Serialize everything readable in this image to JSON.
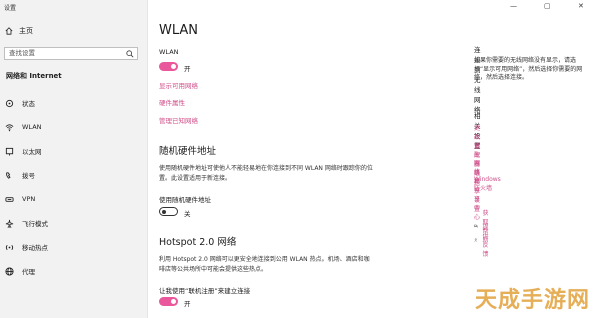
{
  "window": {
    "title": "设置",
    "controls": [
      "—",
      "▢",
      "✕"
    ]
  },
  "sidebar": {
    "home_label": "主页",
    "search_placeholder": "查找设置",
    "section_title": "网络和 Internet",
    "items": [
      {
        "label": "状态",
        "icon": "status-icon"
      },
      {
        "label": "WLAN",
        "icon": "wifi-icon"
      },
      {
        "label": "以太网",
        "icon": "ethernet-icon"
      },
      {
        "label": "拨号",
        "icon": "dialup-icon"
      },
      {
        "label": "VPN",
        "icon": "vpn-icon"
      },
      {
        "label": "飞行模式",
        "icon": "airplane-icon"
      },
      {
        "label": "移动热点",
        "icon": "hotspot-icon"
      },
      {
        "label": "代理",
        "icon": "globe-icon"
      }
    ]
  },
  "main": {
    "title": "WLAN",
    "wlan_label": "WLAN",
    "wlan_state": "开",
    "links": [
      "显示可用网络",
      "硬件属性",
      "管理已知网络"
    ],
    "random_section": {
      "title": "随机硬件地址",
      "description": "使用随机硬件地址可使他人不能轻易地在你连接到不同 WLAN 网络时跟踪你的位置。此设置适用于新连接。",
      "toggle_label": "使用随机硬件地址",
      "toggle_state": "关"
    },
    "hotspot_section": {
      "title": "Hotspot 2.0 网络",
      "description": "利用 Hotspot 2.0 网络可以更安全地连接到公用 WLAN 热点。机场、酒店和咖啡店等公共场所中可能会提供这些热点。",
      "toggle_label": "让我使用“联机注册”来建立连接",
      "toggle_state": "开"
    }
  },
  "right_panel": {
    "connect_title": "连接到无线网络",
    "connect_text": "如果你需要的无线网络没有显示，请选择“显示可用网络”，然后选择你需要的网络，然后选择连接。",
    "related_title": "相关设置",
    "related_links": [
      "更改适配器选项",
      "更改高级共享设置",
      "网络和共享中心",
      "Windows 防火墙"
    ],
    "help_links": [
      {
        "label": "获取帮助",
        "icon": "help-chat-icon"
      },
      {
        "label": "提供反馈",
        "icon": "feedback-icon"
      }
    ]
  },
  "watermark": "天成手游网",
  "colors": {
    "accent": "#d0508a",
    "toggle_on": "#e8589a",
    "sidebar_bg": "#f2f2f2"
  }
}
